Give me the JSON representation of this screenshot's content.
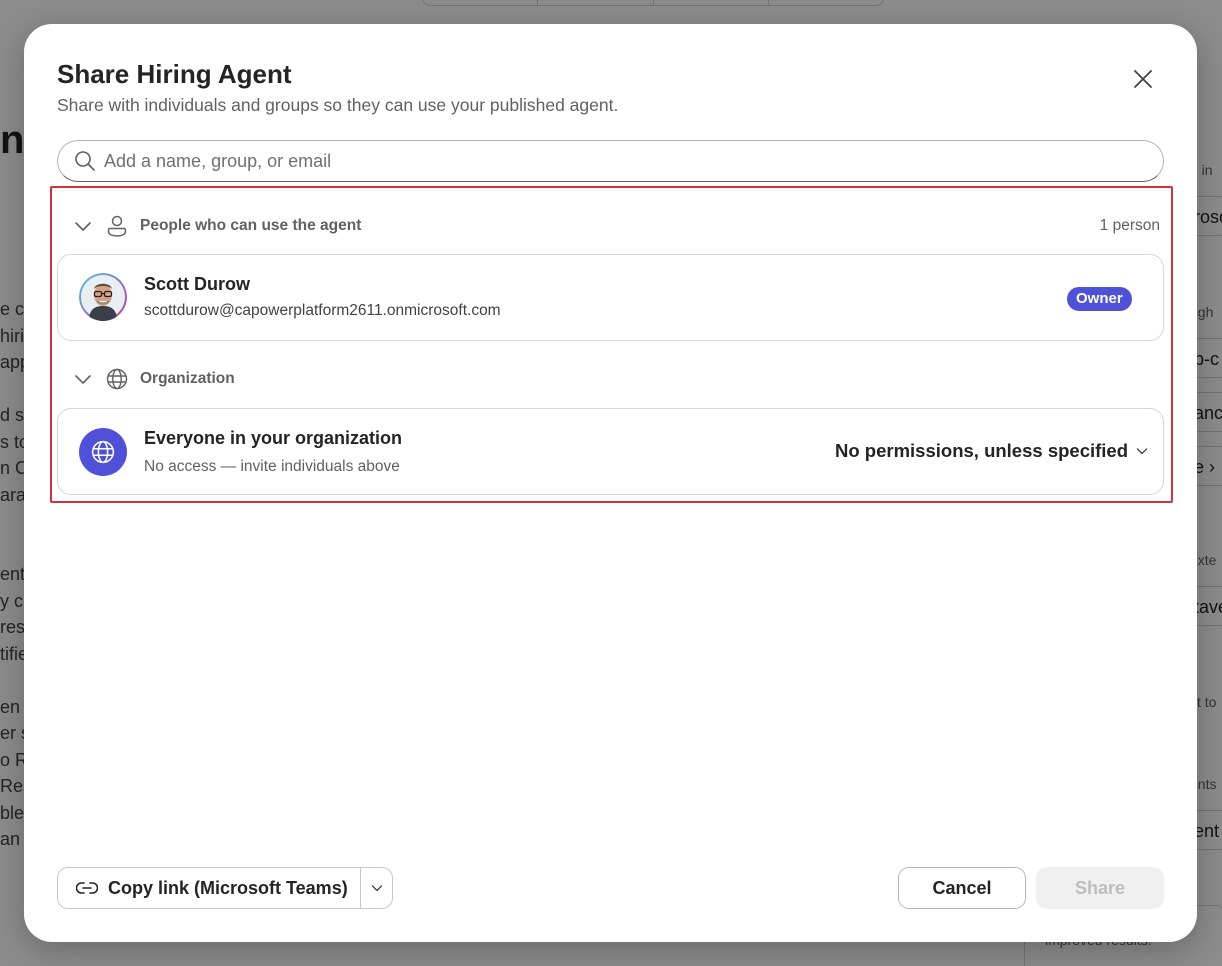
{
  "background": {
    "heading_fragment": "n",
    "left_text_fragments": [
      "e ce",
      "hirin",
      "app",
      "",
      "d sp",
      "s to",
      "n C",
      "arat",
      "",
      "",
      "ent",
      "y c",
      "res",
      "tifie",
      "",
      "en",
      "er s",
      "o Ro",
      "Res",
      "ble",
      "an"
    ],
    "right_fragments": [
      "n in",
      "roso",
      "ugh",
      "p-c",
      "anc",
      "e ›",
      "exte",
      "tave",
      "xt to",
      "ents",
      "ent"
    ],
    "bottom_card_text": "improved results."
  },
  "dialog": {
    "title": "Share Hiring Agent",
    "subtitle": "Share with individuals and groups so they can use your published agent.",
    "search": {
      "placeholder": "Add a name, group, or email",
      "value": ""
    },
    "people_section": {
      "label": "People who can use the agent",
      "count": "1 person",
      "users": [
        {
          "name": "Scott Durow",
          "email": "scottdurow@capowerplatform2611.onmicrosoft.com",
          "role": "Owner"
        }
      ]
    },
    "organization_section": {
      "label": "Organization",
      "entry": {
        "name": "Everyone in your organization",
        "description": "No access — invite individuals above",
        "permission": "No permissions, unless specified"
      }
    },
    "footer": {
      "copy_link_label": "Copy link (Microsoft Teams)",
      "cancel_label": "Cancel",
      "share_label": "Share"
    }
  },
  "colors": {
    "accent": "#4f52d8",
    "highlight_border": "#d13438",
    "overlay": "rgba(0,0,0,0.45)"
  },
  "icons": [
    "search-icon",
    "close-icon",
    "chevron-down-icon",
    "person-icon",
    "globe-icon",
    "link-icon"
  ]
}
